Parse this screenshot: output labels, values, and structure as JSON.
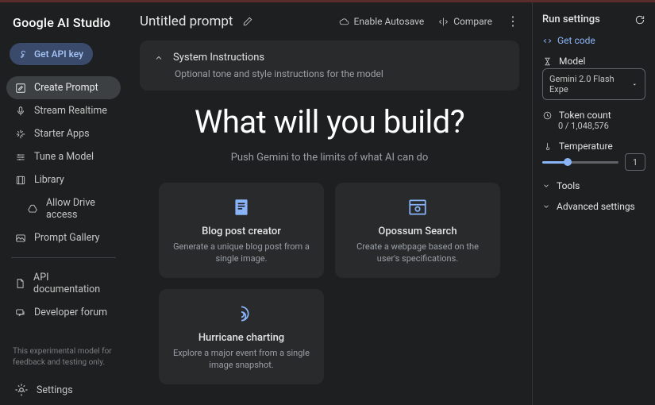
{
  "logo": "Google AI Studio",
  "api_key_btn": "Get API key",
  "sidebar": {
    "items": [
      {
        "label": "Create Prompt"
      },
      {
        "label": "Stream Realtime"
      },
      {
        "label": "Starter Apps"
      },
      {
        "label": "Tune a Model"
      },
      {
        "label": "Library"
      },
      {
        "label": "Allow Drive access"
      },
      {
        "label": "Prompt Gallery"
      }
    ],
    "secondary": [
      {
        "label": "API documentation"
      },
      {
        "label": "Developer forum"
      }
    ],
    "note": "This experimental model for feedback and testing only.",
    "settings": "Settings"
  },
  "header": {
    "title": "Untitled prompt",
    "autosave": "Enable Autosave",
    "compare": "Compare"
  },
  "system": {
    "title": "System Instructions",
    "placeholder": "Optional tone and style instructions for the model"
  },
  "hero": {
    "title": "What will you build?",
    "subtitle": "Push Gemini to the limits of what AI can do"
  },
  "cards": [
    {
      "title": "Blog post creator",
      "desc": "Generate a unique blog post from a single image."
    },
    {
      "title": "Opossum Search",
      "desc": "Create a webpage based on the user's specifications."
    },
    {
      "title": "Hurricane charting",
      "desc": "Explore a major event from a single image snapshot."
    }
  ],
  "run": {
    "title": "Run settings",
    "get_code": "Get code",
    "model_label": "Model",
    "model_value": "Gemini 2.0 Flash Expe",
    "token_label": "Token count",
    "token_value": "0 / 1,048,576",
    "temp_label": "Temperature",
    "temp_value": "1",
    "temp_pct": 33,
    "tools": "Tools",
    "advanced": "Advanced settings"
  }
}
